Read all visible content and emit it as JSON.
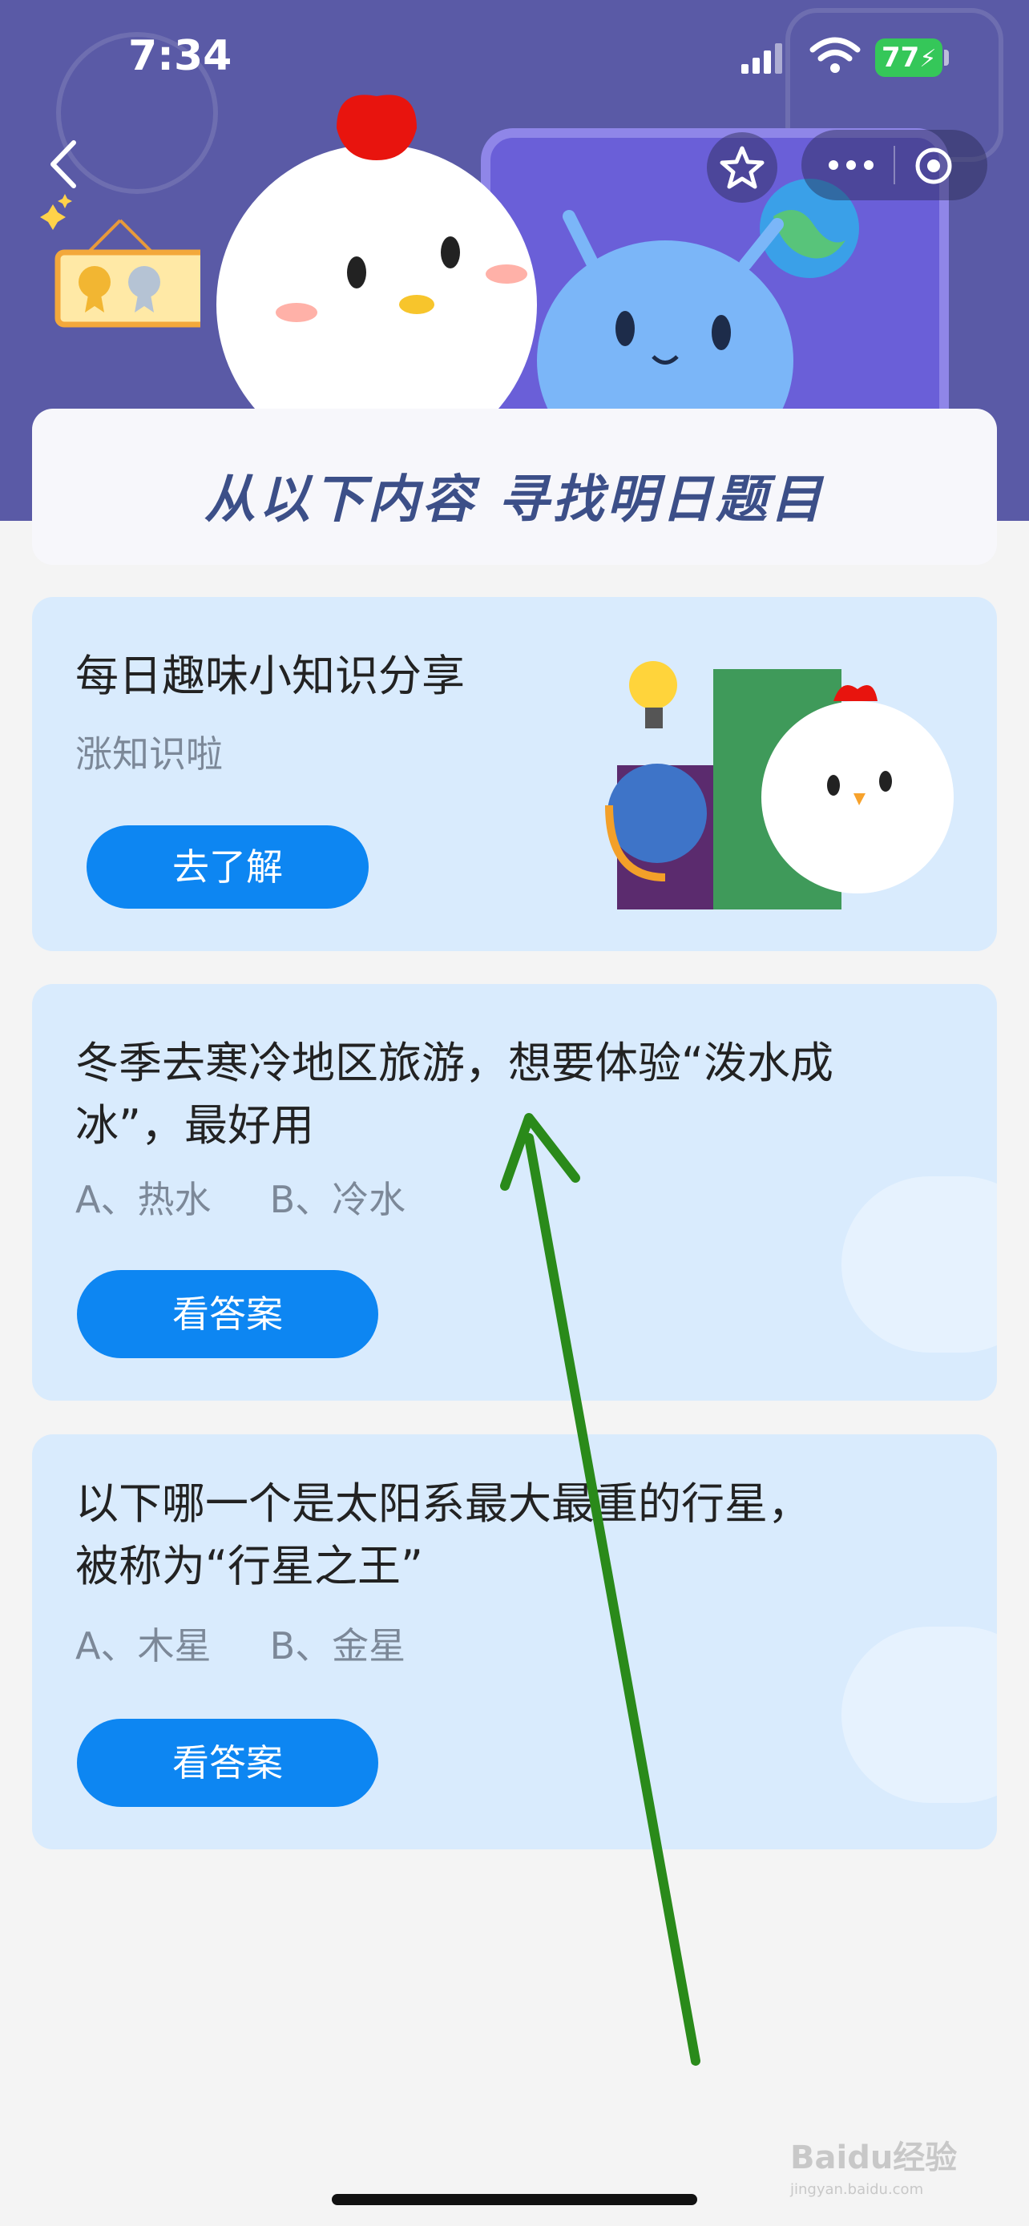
{
  "status_bar": {
    "time": "7:34",
    "battery": "77"
  },
  "banner": {
    "title": "从以下内容 寻找明日题目"
  },
  "cards": [
    {
      "title": "每日趣味小知识分享",
      "subtitle": "涨知识啦",
      "button": "去了解"
    },
    {
      "title_line1": "冬季去寒冷地区旅游，想要体验“泼水成",
      "title_line2": "冰”，最好用",
      "options": "A、热水     B、冷水",
      "button": "看答案"
    },
    {
      "title_line1": "以下哪一个是太阳系最大最重的行星，",
      "title_line2": "被称为“行星之王”",
      "options": "A、木星     B、金星",
      "button": "看答案"
    }
  ],
  "watermark": {
    "brand": "Baidu经验",
    "url": "jingyan.baidu.com"
  },
  "colors": {
    "header": "#5a5aa6",
    "card": "#d9ebfd",
    "button": "#0d86f2",
    "arrow": "#2a8a1a"
  }
}
